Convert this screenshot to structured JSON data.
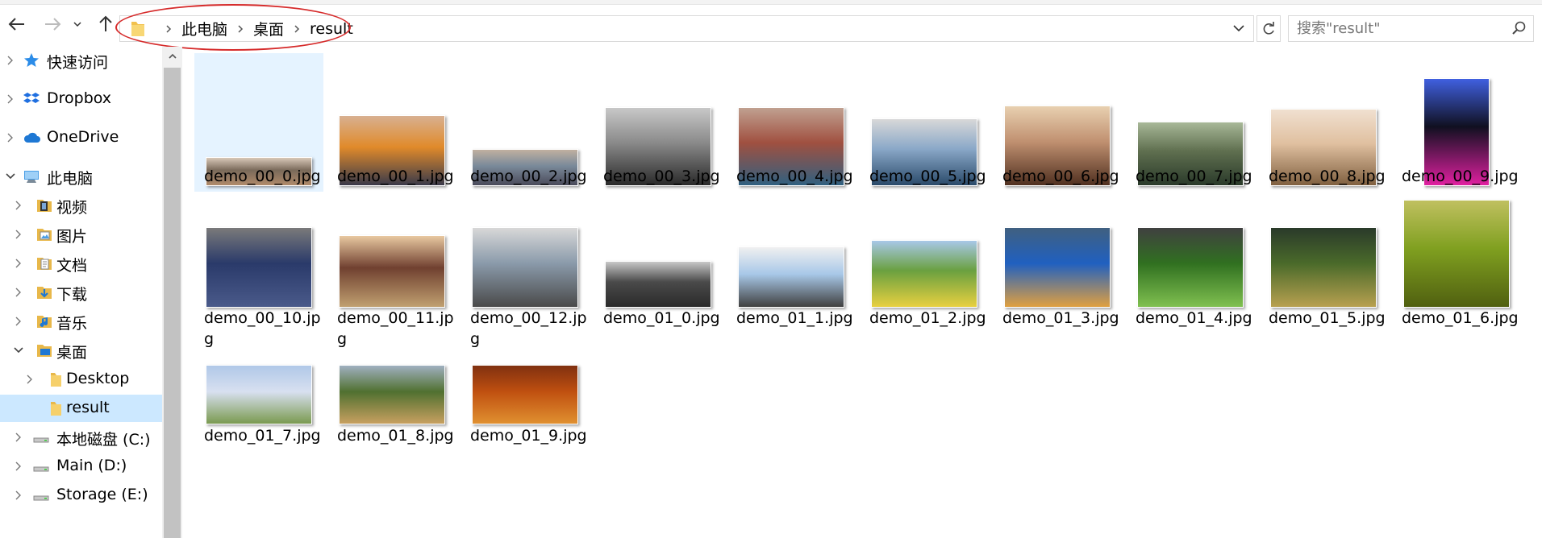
{
  "nav": {
    "back_icon": "back-arrow-icon",
    "forward_icon": "forward-arrow-icon",
    "recent_icon": "chevron-down-icon",
    "up_icon": "up-arrow-icon"
  },
  "address": {
    "breadcrumbs": [
      "此电脑",
      "桌面",
      "result"
    ]
  },
  "search": {
    "placeholder": "搜索\"result\""
  },
  "sidebar": {
    "items": [
      {
        "label": "快速访问",
        "icon": "star-icon"
      },
      {
        "label": "Dropbox",
        "icon": "dropbox-icon"
      },
      {
        "label": "OneDrive",
        "icon": "cloud-icon"
      },
      {
        "label": "此电脑",
        "icon": "computer-icon"
      },
      {
        "label": "视频",
        "icon": "video-folder-icon"
      },
      {
        "label": "图片",
        "icon": "pictures-folder-icon"
      },
      {
        "label": "文档",
        "icon": "documents-folder-icon"
      },
      {
        "label": "下载",
        "icon": "downloads-folder-icon"
      },
      {
        "label": "音乐",
        "icon": "music-folder-icon"
      },
      {
        "label": "桌面",
        "icon": "desktop-folder-icon"
      },
      {
        "label": "Desktop",
        "icon": "folder-icon"
      },
      {
        "label": "result",
        "icon": "folder-icon"
      },
      {
        "label": "本地磁盘 (C:)",
        "icon": "drive-icon"
      },
      {
        "label": "Main (D:)",
        "icon": "drive-icon"
      },
      {
        "label": "Storage (E:)",
        "icon": "drive-icon"
      }
    ]
  },
  "files": [
    {
      "name": "demo_00_0.jpg",
      "name_lines": [
        "demo_00_0.jpg"
      ]
    },
    {
      "name": "demo_00_1.jpg",
      "name_lines": [
        "demo_00_1.jpg"
      ]
    },
    {
      "name": "demo_00_2.jpg",
      "name_lines": [
        "demo_00_2.jpg"
      ]
    },
    {
      "name": "demo_00_3.jpg",
      "name_lines": [
        "demo_00_3.jpg"
      ]
    },
    {
      "name": "demo_00_4.jpg",
      "name_lines": [
        "demo_00_4.jpg"
      ]
    },
    {
      "name": "demo_00_5.jpg",
      "name_lines": [
        "demo_00_5.jpg"
      ]
    },
    {
      "name": "demo_00_6.jpg",
      "name_lines": [
        "demo_00_6.jpg"
      ]
    },
    {
      "name": "demo_00_7.jpg",
      "name_lines": [
        "demo_00_7.jpg"
      ]
    },
    {
      "name": "demo_00_8.jpg",
      "name_lines": [
        "demo_00_8.jpg"
      ]
    },
    {
      "name": "demo_00_9.jpg",
      "name_lines": [
        "demo_00_9.jpg"
      ]
    },
    {
      "name": "demo_00_10.jpg",
      "name_lines": [
        "demo_00_10.jp",
        "g"
      ]
    },
    {
      "name": "demo_00_11.jpg",
      "name_lines": [
        "demo_00_11.jp",
        "g"
      ]
    },
    {
      "name": "demo_00_12.jpg",
      "name_lines": [
        "demo_00_12.jp",
        "g"
      ]
    },
    {
      "name": "demo_01_0.jpg",
      "name_lines": [
        "demo_01_0.jpg"
      ]
    },
    {
      "name": "demo_01_1.jpg",
      "name_lines": [
        "demo_01_1.jpg"
      ]
    },
    {
      "name": "demo_01_2.jpg",
      "name_lines": [
        "demo_01_2.jpg"
      ]
    },
    {
      "name": "demo_01_3.jpg",
      "name_lines": [
        "demo_01_3.jpg"
      ]
    },
    {
      "name": "demo_01_4.jpg",
      "name_lines": [
        "demo_01_4.jpg"
      ]
    },
    {
      "name": "demo_01_5.jpg",
      "name_lines": [
        "demo_01_5.jpg"
      ]
    },
    {
      "name": "demo_01_6.jpg",
      "name_lines": [
        "demo_01_6.jpg"
      ]
    },
    {
      "name": "demo_01_7.jpg",
      "name_lines": [
        "demo_01_7.jpg"
      ]
    },
    {
      "name": "demo_01_8.jpg",
      "name_lines": [
        "demo_01_8.jpg"
      ]
    },
    {
      "name": "demo_01_9.jpg",
      "name_lines": [
        "demo_01_9.jpg"
      ]
    }
  ],
  "colors": {
    "selection": "#cce8ff",
    "selected_tile": "#e5f3ff",
    "annotation_oval": "#d62b2b"
  }
}
